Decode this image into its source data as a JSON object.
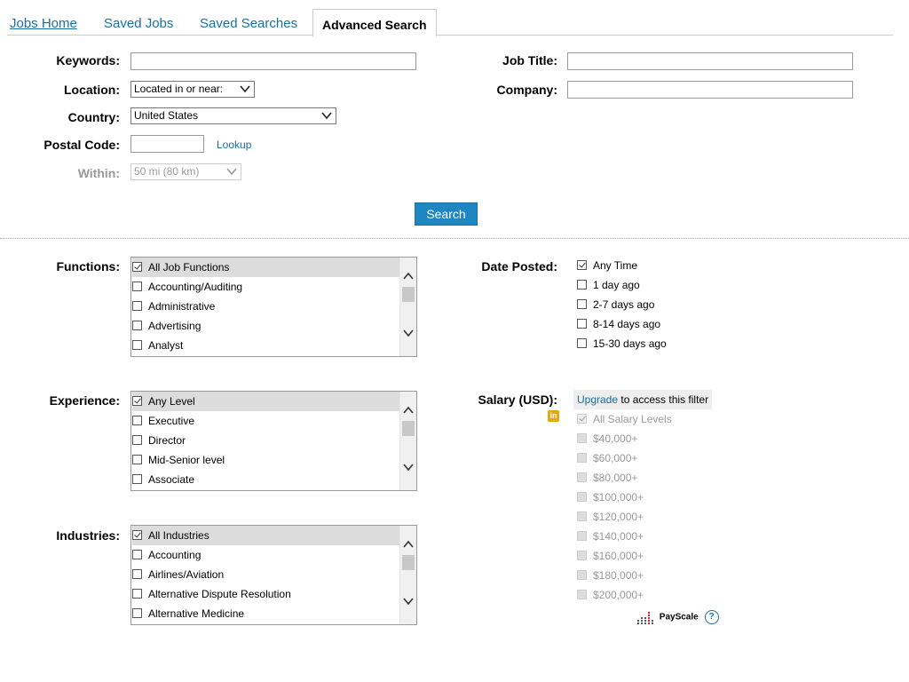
{
  "tabs": [
    {
      "label": "Jobs Home"
    },
    {
      "label": "Saved Jobs"
    },
    {
      "label": "Saved Searches"
    },
    {
      "label": "Advanced Search"
    }
  ],
  "form": {
    "keywords_label": "Keywords:",
    "keywords_value": "",
    "job_title_label": "Job Title:",
    "job_title_value": "",
    "location_label": "Location:",
    "location_value": "Located in or near:",
    "company_label": "Company:",
    "company_value": "",
    "country_label": "Country:",
    "country_value": "United States",
    "postal_label": "Postal Code:",
    "postal_value": "",
    "lookup_label": "Lookup",
    "within_label": "Within:",
    "within_value": "50 mi (80 km)",
    "search_label": "Search"
  },
  "functions": {
    "label": "Functions:",
    "items": [
      "All Job Functions",
      "Accounting/Auditing",
      "Administrative",
      "Advertising",
      "Analyst"
    ]
  },
  "experience": {
    "label": "Experience:",
    "items": [
      "Any Level",
      "Executive",
      "Director",
      "Mid-Senior level",
      "Associate"
    ]
  },
  "industries": {
    "label": "Industries:",
    "items": [
      "All Industries",
      "Accounting",
      "Airlines/Aviation",
      "Alternative Dispute Resolution",
      "Alternative Medicine"
    ]
  },
  "date_posted": {
    "label": "Date Posted:",
    "items": [
      "Any Time",
      "1 day ago",
      "2-7 days ago",
      "8-14 days ago",
      "15-30 days ago"
    ]
  },
  "salary": {
    "label": "Salary (USD):",
    "upgrade_link": "Upgrade",
    "upgrade_text": " to access this filter",
    "items": [
      "All Salary Levels",
      "$40,000+",
      "$60,000+",
      "$80,000+",
      "$100,000+",
      "$120,000+",
      "$140,000+",
      "$160,000+",
      "$180,000+",
      "$200,000+"
    ],
    "linkedin_icon": "in",
    "payscale_label": "PayScale",
    "help_label": "?"
  },
  "colors": {
    "link": "#1a6fa1",
    "button": "#1e86c0",
    "linkedin_gold": "#e8a317"
  }
}
